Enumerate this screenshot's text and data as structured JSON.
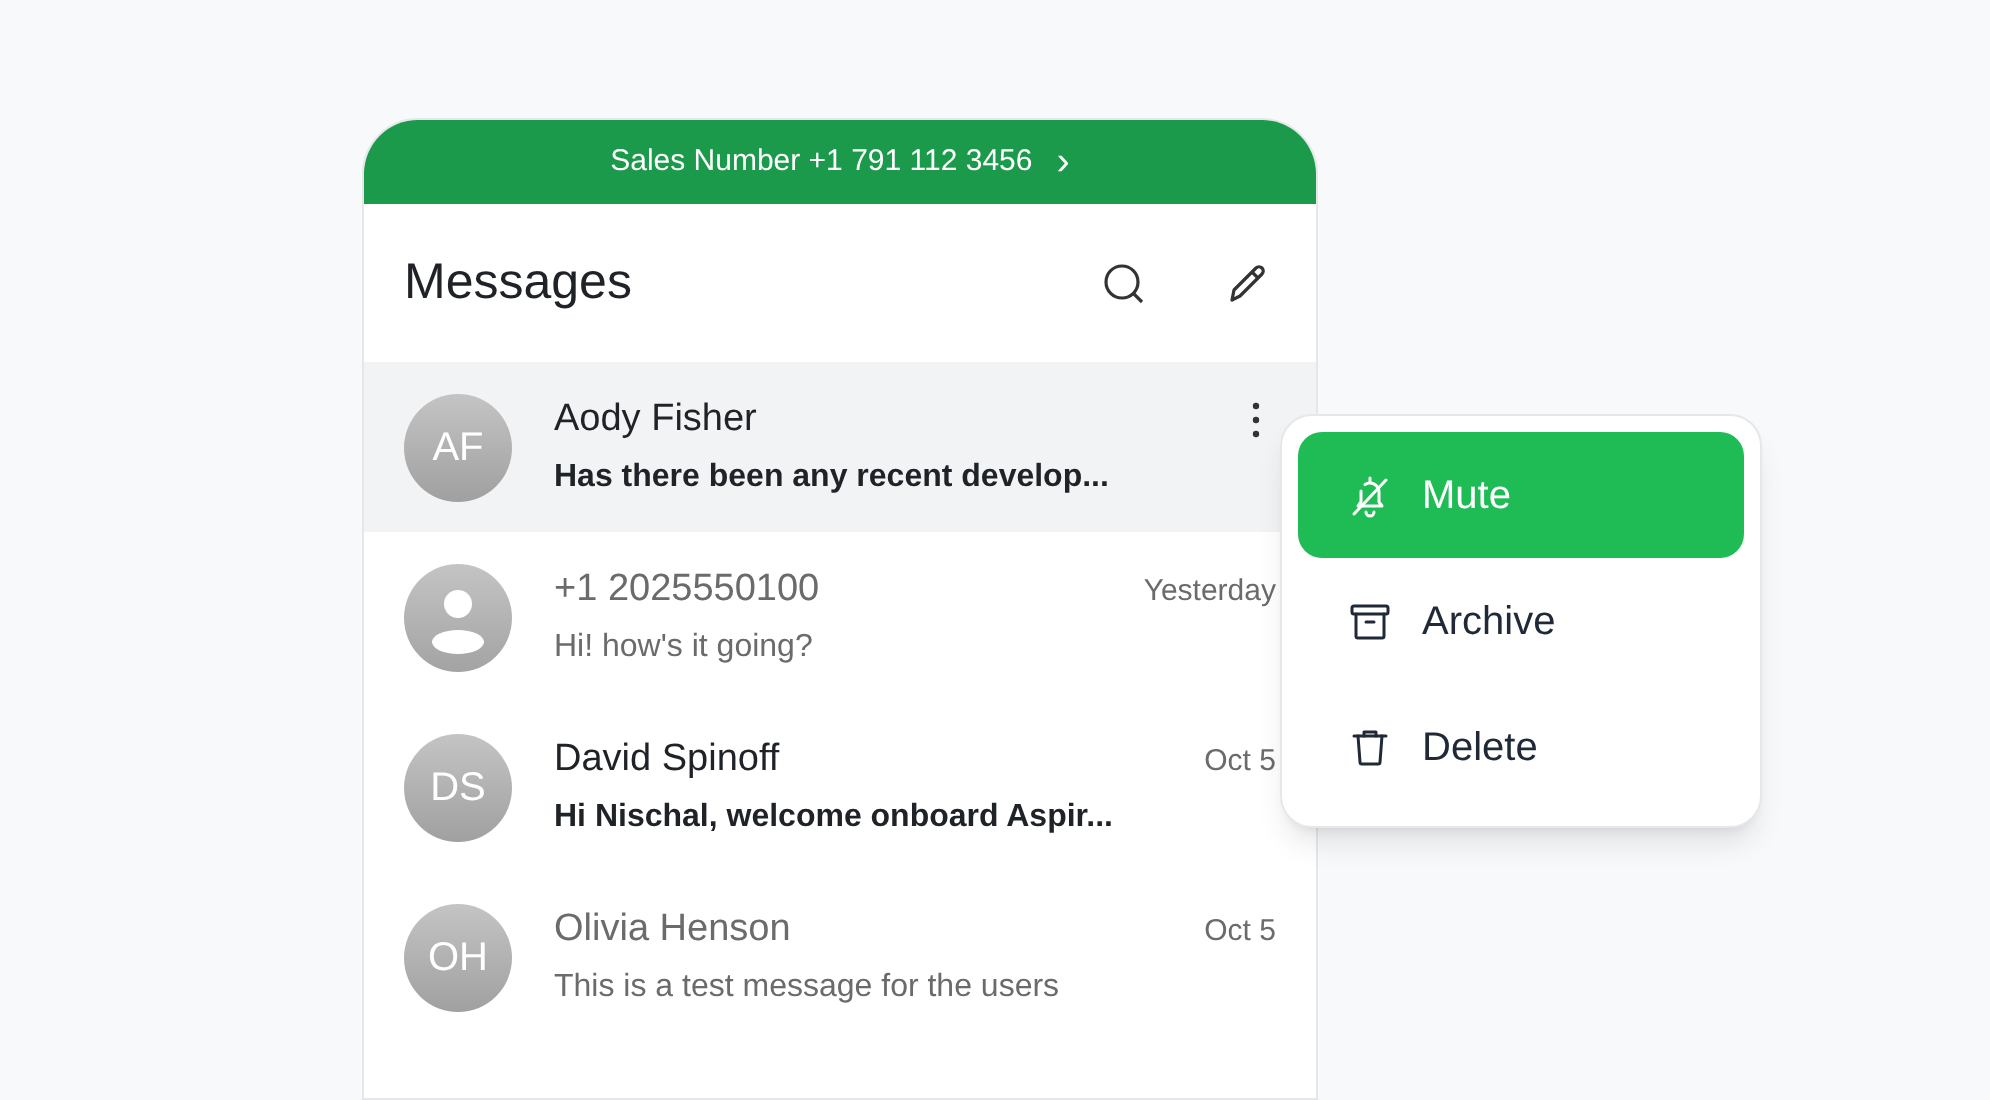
{
  "banner": {
    "text": "Sales Number +1 791 112 3456",
    "chevron": "›"
  },
  "header": {
    "title": "Messages"
  },
  "conversations": [
    {
      "kind": "initials",
      "initials": "AF",
      "name": "Aody Fisher",
      "preview": "Has there been any recent develop...",
      "unread": true,
      "selected": true
    },
    {
      "kind": "person",
      "name": "+1 2025550100",
      "time": "Yesterday",
      "preview": "Hi! how's it going?",
      "unread": false,
      "selected": false
    },
    {
      "kind": "initials",
      "initials": "DS",
      "name": "David Spinoff",
      "time": "Oct 5",
      "preview": "Hi Nischal, welcome onboard Aspir...",
      "unread": true,
      "selected": false
    },
    {
      "kind": "initials",
      "initials": "OH",
      "name": "Olivia Henson",
      "time": "Oct 5",
      "preview": "This is a test message for the users",
      "unread": false,
      "selected": false
    }
  ],
  "context_menu": [
    {
      "kind": "mute",
      "label": "Mute",
      "selected": true
    },
    {
      "kind": "archive",
      "label": "Archive",
      "selected": false
    },
    {
      "kind": "delete",
      "label": "Delete",
      "selected": false
    }
  ]
}
